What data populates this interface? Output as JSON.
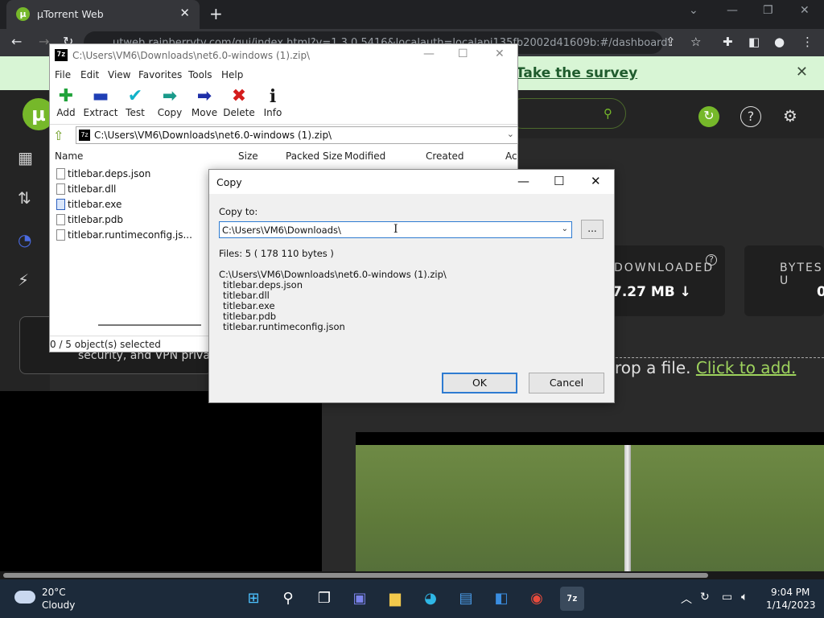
{
  "browser": {
    "tab_title": "µTorrent Web",
    "tab_favicon": "µ",
    "new_tab": "+",
    "url": "utweb.rainberrytv.com/gui/index.html?v=1.3.0.5416&localauth=localapi135fb2002d41609b:#/dashboard",
    "window_controls": {
      "minimize": "—",
      "restore": "❐",
      "close": "✕"
    }
  },
  "utorrent": {
    "survey_link": "Take the survey",
    "vpn_text": "security, and VPN privac",
    "downloaded_label": "DOWNLOADED",
    "downloaded_value": "7.27 MB ↓",
    "bytes_label": "BYTES U",
    "bytes_value": "0",
    "drop_text": "rop a file. ",
    "drop_add": "Click to add.",
    "accent": "#76b82a"
  },
  "zip": {
    "title": "C:\\Users\\VM6\\Downloads\\net6.0-windows (1).zip\\",
    "menu": [
      "File",
      "Edit",
      "View",
      "Favorites",
      "Tools",
      "Help"
    ],
    "tools": [
      {
        "label": "Add",
        "icon": "+",
        "color": "#21a33b"
      },
      {
        "label": "Extract",
        "icon": "▬",
        "color": "#1f3fb5"
      },
      {
        "label": "Test",
        "icon": "✔",
        "color": "#12b2c9"
      },
      {
        "label": "Copy",
        "icon": "➡",
        "color": "#1a9a8a"
      },
      {
        "label": "Move",
        "icon": "➡",
        "color": "#1f2fa8"
      },
      {
        "label": "Delete",
        "icon": "✖",
        "color": "#d41c1c"
      },
      {
        "label": "Info",
        "icon": "i",
        "color": "#1a1a1a"
      }
    ],
    "address": "C:\\Users\\VM6\\Downloads\\net6.0-windows (1).zip\\",
    "columns": [
      "Name",
      "Size",
      "Packed Size",
      "Modified",
      "Created",
      "Ac"
    ],
    "files": [
      "titlebar.deps.json",
      "titlebar.dll",
      "titlebar.exe",
      "titlebar.pdb",
      "titlebar.runtimeconfig.js..."
    ],
    "status": "0 / 5 object(s) selected"
  },
  "copy_dialog": {
    "title": "Copy",
    "copy_to_label": "Copy to:",
    "destination": "C:\\Users\\VM6\\Downloads\\",
    "browse_label": "...",
    "files_summary": "Files: 5    ( 178 110 bytes )",
    "source_path": "C:\\Users\\VM6\\Downloads\\net6.0-windows (1).zip\\",
    "file_list": [
      "titlebar.deps.json",
      "titlebar.dll",
      "titlebar.exe",
      "titlebar.pdb",
      "titlebar.runtimeconfig.json"
    ],
    "ok_label": "OK",
    "cancel_label": "Cancel"
  },
  "taskbar": {
    "temperature": "20°C",
    "weather": "Cloudy",
    "time": "9:04 PM",
    "date": "1/14/2023"
  }
}
